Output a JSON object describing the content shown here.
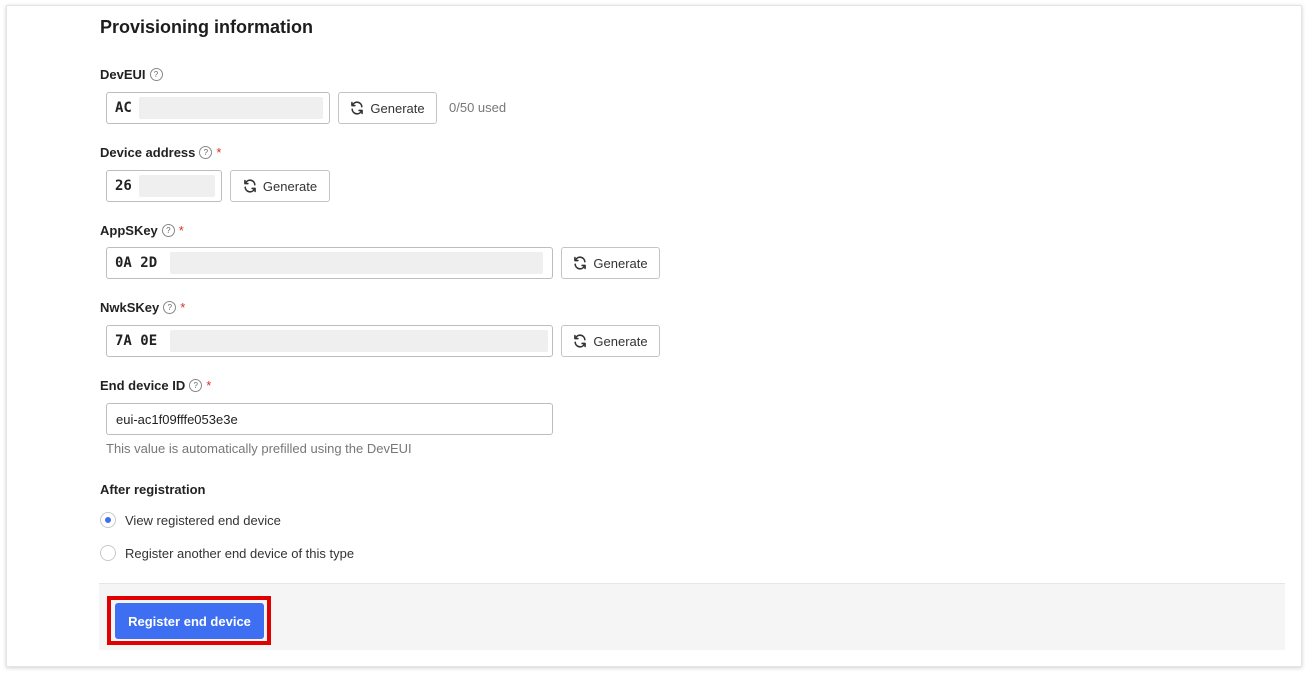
{
  "section": {
    "title": "Provisioning information"
  },
  "dev_eui": {
    "label": "DevEUI",
    "value": "AC",
    "generate_label": "Generate",
    "usage": "0/50 used"
  },
  "device_address": {
    "label": "Device address",
    "required_mark": "*",
    "value": "26",
    "generate_label": "Generate"
  },
  "app_skey": {
    "label": "AppSKey",
    "required_mark": "*",
    "value": "0A 2D",
    "generate_label": "Generate"
  },
  "nwk_skey": {
    "label": "NwkSKey",
    "required_mark": "*",
    "value": "7A 0E",
    "generate_label": "Generate"
  },
  "end_device_id": {
    "label": "End device ID",
    "required_mark": "*",
    "value": "eui-ac1f09fffe053e3e",
    "hint": "This value is automatically prefilled using the DevEUI"
  },
  "after_registration": {
    "label": "After registration",
    "options": [
      {
        "label": "View registered end device",
        "selected": true
      },
      {
        "label": "Register another end device of this type",
        "selected": false
      }
    ]
  },
  "footer": {
    "submit_label": "Register end device"
  },
  "icons": {
    "help": "help-circle-icon",
    "generate": "refresh-icon"
  },
  "colors": {
    "primary": "#3e6ff2",
    "required": "#d93025",
    "highlight": "#e00000"
  }
}
